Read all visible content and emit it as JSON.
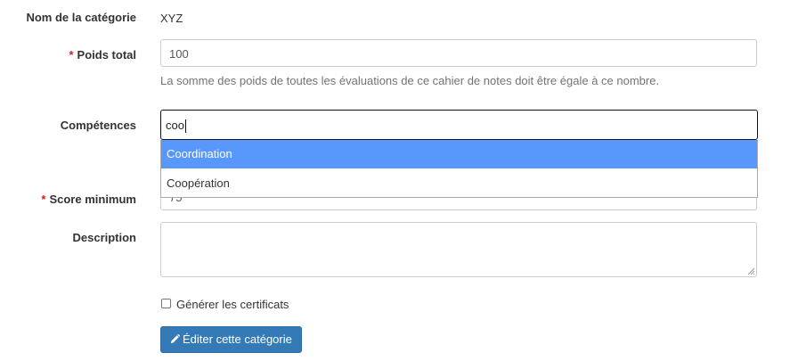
{
  "category_name": {
    "label": "Nom de la catégorie",
    "value": "XYZ"
  },
  "total_weight": {
    "required_mark": "*",
    "label": "Poids total",
    "value": "100",
    "help": "La somme des poids de toutes les évaluations de ce cahier de notes doit être égale à ce nombre."
  },
  "skills": {
    "label": "Compétences",
    "search_value": "coo",
    "options": [
      "Coordination",
      "Coopération"
    ],
    "highlighted_option": "Coordination"
  },
  "min_score": {
    "required_mark": "*",
    "label": "Score minimum",
    "value": "75"
  },
  "description": {
    "label": "Description",
    "value": ""
  },
  "certificates": {
    "label": "Générer les certificats",
    "checked": false
  },
  "submit": {
    "icon": "pencil-icon",
    "label": "Éditer cette catégorie",
    "color": "#337ab7"
  }
}
